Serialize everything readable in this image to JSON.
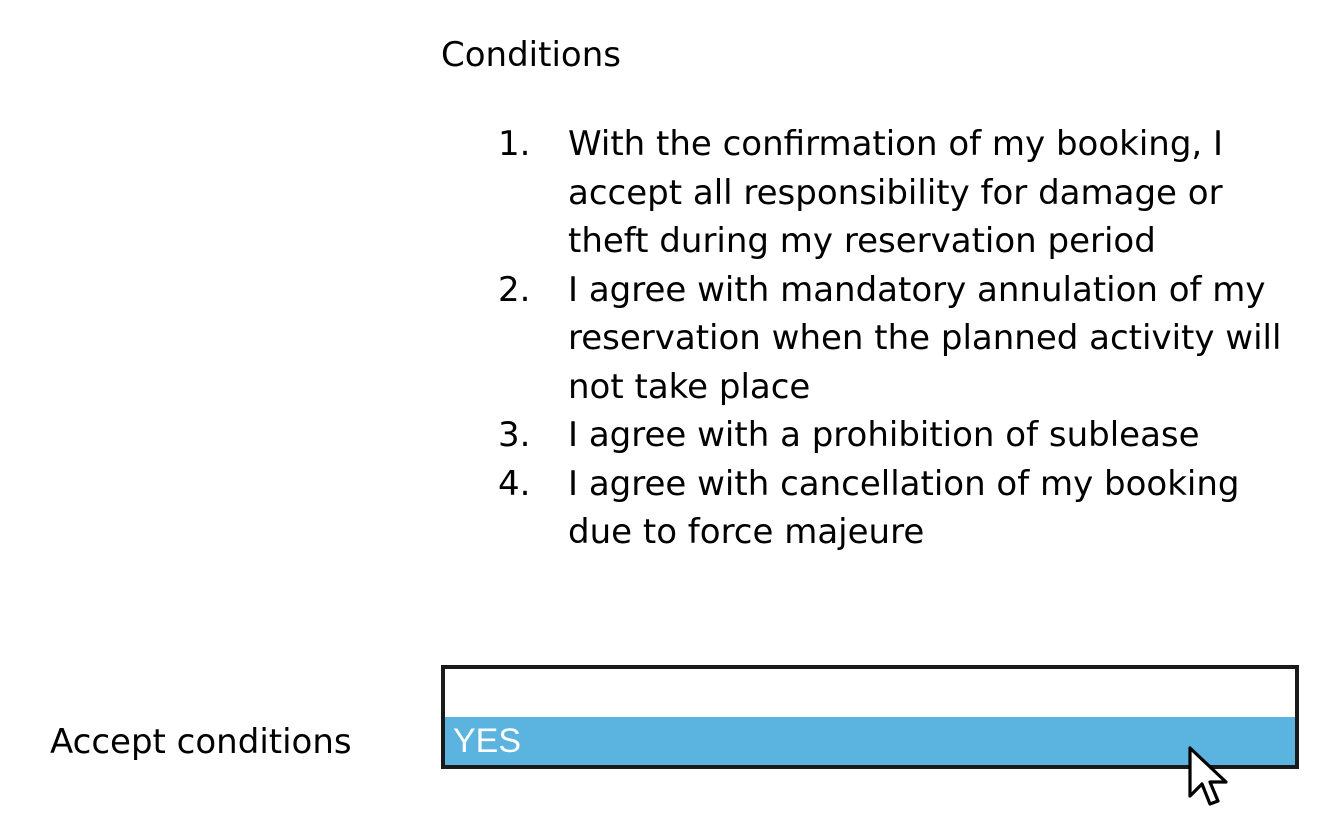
{
  "conditions": {
    "heading": "Conditions",
    "items": [
      {
        "number": "1.",
        "text": "With the confirmation of my booking, I accept all responsibility for damage or theft during my reservation period"
      },
      {
        "number": "2.",
        "text": "I agree with mandatory annulation of my reservation when the planned activity will not take place"
      },
      {
        "number": "3.",
        "text": "I agree with a prohibition of sublease"
      },
      {
        "number": "4.",
        "text": "I agree with cancellation of my booking due to force majeure"
      }
    ]
  },
  "accept": {
    "label": "Accept conditions",
    "options": [
      "",
      "YES"
    ],
    "selected": "YES",
    "highlight_color": "#5bb3e0"
  },
  "cursor": {
    "icon": "mouse-pointer-icon"
  }
}
